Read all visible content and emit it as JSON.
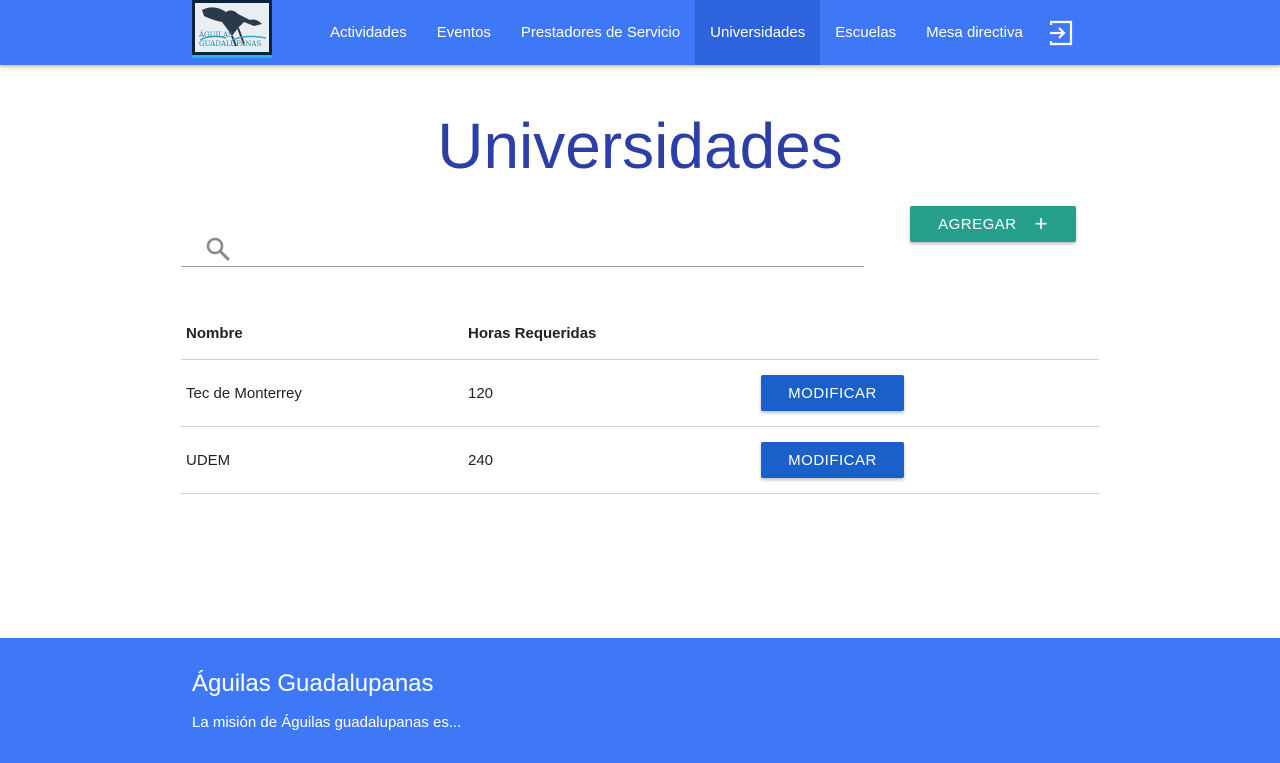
{
  "header": {
    "logo_text": "ÁGUILAS GUADALUPANAS",
    "nav": [
      {
        "label": "Actividades",
        "active": false
      },
      {
        "label": "Eventos",
        "active": false
      },
      {
        "label": "Prestadores de Servicio",
        "active": false
      },
      {
        "label": "Universidades",
        "active": true
      },
      {
        "label": "Escuelas",
        "active": false
      },
      {
        "label": "Mesa directiva",
        "active": false
      }
    ],
    "logout_icon": "logout-icon"
  },
  "main": {
    "title": "Universidades",
    "search": {
      "placeholder": "",
      "value": "",
      "icon": "search-icon"
    },
    "add_button": {
      "label": "AGREGAR",
      "icon": "plus-icon"
    },
    "table": {
      "columns": [
        "Nombre",
        "Horas Requeridas"
      ],
      "rows": [
        {
          "nombre": "Tec de Monterrey",
          "horas": "120",
          "action": "MODIFICAR"
        },
        {
          "nombre": "UDEM",
          "horas": "240",
          "action": "MODIFICAR"
        }
      ]
    }
  },
  "footer": {
    "title": "Águilas Guadalupanas",
    "text": "La misión de Águilas guadalupanas es..."
  },
  "colors": {
    "primary": "#3f78f6",
    "active_nav": "#2d64de",
    "title": "#2b3fa7",
    "add_button": "#26a08a",
    "modify_button": "#1a5fca"
  }
}
